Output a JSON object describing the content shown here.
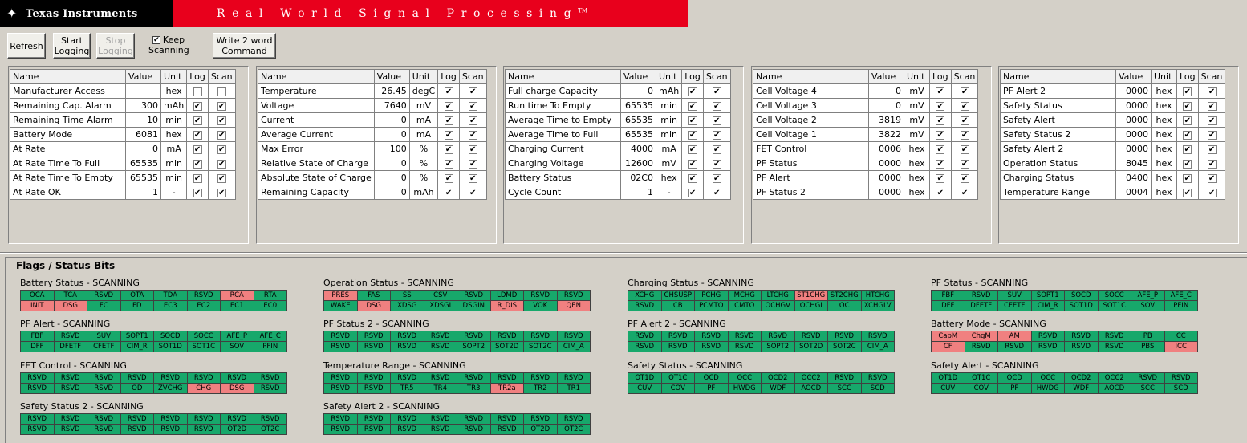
{
  "banner": {
    "company": "Texas Instruments",
    "tagline": "Real World Signal Processing",
    "tm": "TM"
  },
  "toolbar": {
    "refresh": "Refresh",
    "start_logging": "Start\nLogging",
    "stop_logging": "Stop\nLogging",
    "keep_scanning": "Keep\nScanning",
    "keep_checked": "✔",
    "write_cmd": "Write 2 word\nCommand"
  },
  "columns": {
    "name": "Name",
    "value": "Value",
    "unit": "Unit",
    "log": "Log",
    "scan": "Scan"
  },
  "panels": [
    {
      "rows": [
        {
          "name": "Manufacturer Access",
          "value": "",
          "unit": "hex",
          "log": false,
          "scan": false
        },
        {
          "name": "Remaining Cap. Alarm",
          "value": "300",
          "unit": "mAh",
          "log": true,
          "scan": true
        },
        {
          "name": "Remaining Time Alarm",
          "value": "10",
          "unit": "min",
          "log": true,
          "scan": true
        },
        {
          "name": "Battery Mode",
          "value": "6081",
          "unit": "hex",
          "log": true,
          "scan": true
        },
        {
          "name": "At Rate",
          "value": "0",
          "unit": "mA",
          "log": true,
          "scan": true
        },
        {
          "name": "At Rate Time To Full",
          "value": "65535",
          "unit": "min",
          "log": true,
          "scan": true
        },
        {
          "name": "At Rate Time To Empty",
          "value": "65535",
          "unit": "min",
          "log": true,
          "scan": true
        },
        {
          "name": "At Rate OK",
          "value": "1",
          "unit": "-",
          "log": true,
          "scan": true
        }
      ]
    },
    {
      "rows": [
        {
          "name": "Temperature",
          "value": "26.45",
          "unit": "degC",
          "log": true,
          "scan": true
        },
        {
          "name": "Voltage",
          "value": "7640",
          "unit": "mV",
          "log": true,
          "scan": true
        },
        {
          "name": "Current",
          "value": "0",
          "unit": "mA",
          "log": true,
          "scan": true
        },
        {
          "name": "Average Current",
          "value": "0",
          "unit": "mA",
          "log": true,
          "scan": true
        },
        {
          "name": "Max Error",
          "value": "100",
          "unit": "%",
          "log": true,
          "scan": true
        },
        {
          "name": "Relative State of Charge",
          "value": "0",
          "unit": "%",
          "log": true,
          "scan": true
        },
        {
          "name": "Absolute State of Charge",
          "value": "0",
          "unit": "%",
          "log": true,
          "scan": true
        },
        {
          "name": "Remaining Capacity",
          "value": "0",
          "unit": "mAh",
          "log": true,
          "scan": true
        }
      ]
    },
    {
      "rows": [
        {
          "name": "Full charge Capacity",
          "value": "0",
          "unit": "mAh",
          "log": true,
          "scan": true
        },
        {
          "name": "Run time To Empty",
          "value": "65535",
          "unit": "min",
          "log": true,
          "scan": true
        },
        {
          "name": "Average Time to Empty",
          "value": "65535",
          "unit": "min",
          "log": true,
          "scan": true
        },
        {
          "name": "Average Time to Full",
          "value": "65535",
          "unit": "min",
          "log": true,
          "scan": true
        },
        {
          "name": "Charging Current",
          "value": "4000",
          "unit": "mA",
          "log": true,
          "scan": true
        },
        {
          "name": "Charging Voltage",
          "value": "12600",
          "unit": "mV",
          "log": true,
          "scan": true
        },
        {
          "name": "Battery Status",
          "value": "02C0",
          "unit": "hex",
          "log": true,
          "scan": true
        },
        {
          "name": "Cycle Count",
          "value": "1",
          "unit": "-",
          "log": true,
          "scan": true
        }
      ]
    },
    {
      "rows": [
        {
          "name": "Cell Voltage 4",
          "value": "0",
          "unit": "mV",
          "log": true,
          "scan": true
        },
        {
          "name": "Cell Voltage 3",
          "value": "0",
          "unit": "mV",
          "log": true,
          "scan": true
        },
        {
          "name": "Cell Voltage 2",
          "value": "3819",
          "unit": "mV",
          "log": true,
          "scan": true
        },
        {
          "name": "Cell Voltage 1",
          "value": "3822",
          "unit": "mV",
          "log": true,
          "scan": true
        },
        {
          "name": "FET Control",
          "value": "0006",
          "unit": "hex",
          "log": true,
          "scan": true
        },
        {
          "name": "PF Status",
          "value": "0000",
          "unit": "hex",
          "log": true,
          "scan": true
        },
        {
          "name": "PF Alert",
          "value": "0000",
          "unit": "hex",
          "log": true,
          "scan": true
        },
        {
          "name": "PF Status 2",
          "value": "0000",
          "unit": "hex",
          "log": true,
          "scan": true
        }
      ]
    },
    {
      "rows": [
        {
          "name": "PF Alert 2",
          "value": "0000",
          "unit": "hex",
          "log": true,
          "scan": true
        },
        {
          "name": "Safety Status",
          "value": "0000",
          "unit": "hex",
          "log": true,
          "scan": true
        },
        {
          "name": "Safety Alert",
          "value": "0000",
          "unit": "hex",
          "log": true,
          "scan": true
        },
        {
          "name": "Safety Status 2",
          "value": "0000",
          "unit": "hex",
          "log": true,
          "scan": true
        },
        {
          "name": "Safety Alert 2",
          "value": "0000",
          "unit": "hex",
          "log": true,
          "scan": true
        },
        {
          "name": "Operation Status",
          "value": "8045",
          "unit": "hex",
          "log": true,
          "scan": true
        },
        {
          "name": "Charging Status",
          "value": "0400",
          "unit": "hex",
          "log": true,
          "scan": true
        },
        {
          "name": "Temperature Range",
          "value": "0004",
          "unit": "hex",
          "log": true,
          "scan": true
        }
      ]
    }
  ],
  "flags_title": "Flags / Status Bits",
  "flag_groups": [
    {
      "title": "Battery Status - SCANNING",
      "rows": [
        [
          "OCA",
          "TCA",
          "RSVD",
          "OTA",
          "TDA",
          "RSVD",
          "RCA",
          "RTA"
        ],
        [
          "INIT",
          "DSG",
          "FC",
          "FD",
          "EC3",
          "EC2",
          "EC1",
          "EC0"
        ]
      ],
      "set": [
        [
          0,
          0,
          0,
          0,
          0,
          0,
          1,
          0
        ],
        [
          1,
          1,
          0,
          0,
          0,
          0,
          0,
          0
        ]
      ]
    },
    {
      "title": "Operation Status - SCANNING",
      "rows": [
        [
          "PRES",
          "FAS",
          "SS",
          "CSV",
          "RSVD",
          "LDMD",
          "RSVD",
          "RSVD"
        ],
        [
          "WAKE",
          "DSG",
          "XDSG",
          "XDSGI",
          "DSGIN",
          "R_DIS",
          "VOK",
          "QEN"
        ]
      ],
      "set": [
        [
          1,
          0,
          0,
          0,
          0,
          0,
          0,
          0
        ],
        [
          0,
          1,
          0,
          0,
          0,
          1,
          0,
          1
        ]
      ]
    },
    {
      "title": "Charging Status - SCANNING",
      "rows": [
        [
          "XCHG",
          "CHSUSP",
          "PCHG",
          "MCHG",
          "LTCHG",
          "ST1CHG",
          "ST2CHG",
          "HTCHG"
        ],
        [
          "RSVD",
          "CB",
          "PCMTO",
          "CMTO",
          "OCHGV",
          "OCHGI",
          "OC",
          "XCHGLV"
        ]
      ],
      "set": [
        [
          0,
          0,
          0,
          0,
          0,
          1,
          0,
          0
        ],
        [
          0,
          0,
          0,
          0,
          0,
          0,
          0,
          0
        ]
      ]
    },
    {
      "title": "PF Status - SCANNING",
      "rows": [
        [
          "FBF",
          "RSVD",
          "SUV",
          "SOPT1",
          "SOCD",
          "SOCC",
          "AFE_P",
          "AFE_C"
        ],
        [
          "DFF",
          "DFETF",
          "CFETF",
          "CIM_R",
          "SOT1D",
          "SOT1C",
          "SOV",
          "PFIN"
        ]
      ],
      "set": [
        [
          0,
          0,
          0,
          0,
          0,
          0,
          0,
          0
        ],
        [
          0,
          0,
          0,
          0,
          0,
          0,
          0,
          0
        ]
      ]
    },
    {
      "title": "PF Alert - SCANNING",
      "rows": [
        [
          "FBF",
          "RSVD",
          "SUV",
          "SOPT1",
          "SOCD",
          "SOCC",
          "AFE_P",
          "AFE_C"
        ],
        [
          "DFF",
          "DFETF",
          "CFETF",
          "CIM_R",
          "SOT1D",
          "SOT1C",
          "SOV",
          "PFIN"
        ]
      ],
      "set": [
        [
          0,
          0,
          0,
          0,
          0,
          0,
          0,
          0
        ],
        [
          0,
          0,
          0,
          0,
          0,
          0,
          0,
          0
        ]
      ]
    },
    {
      "title": "PF Status 2 - SCANNING",
      "rows": [
        [
          "RSVD",
          "RSVD",
          "RSVD",
          "RSVD",
          "RSVD",
          "RSVD",
          "RSVD",
          "RSVD"
        ],
        [
          "RSVD",
          "RSVD",
          "RSVD",
          "RSVD",
          "SOPT2",
          "SOT2D",
          "SOT2C",
          "CIM_A"
        ]
      ],
      "set": [
        [
          0,
          0,
          0,
          0,
          0,
          0,
          0,
          0
        ],
        [
          0,
          0,
          0,
          0,
          0,
          0,
          0,
          0
        ]
      ]
    },
    {
      "title": "PF Alert 2 - SCANNING",
      "rows": [
        [
          "RSVD",
          "RSVD",
          "RSVD",
          "RSVD",
          "RSVD",
          "RSVD",
          "RSVD",
          "RSVD"
        ],
        [
          "RSVD",
          "RSVD",
          "RSVD",
          "RSVD",
          "SOPT2",
          "SOT2D",
          "SOT2C",
          "CIM_A"
        ]
      ],
      "set": [
        [
          0,
          0,
          0,
          0,
          0,
          0,
          0,
          0
        ],
        [
          0,
          0,
          0,
          0,
          0,
          0,
          0,
          0
        ]
      ]
    },
    {
      "title": "Battery Mode - SCANNING",
      "rows": [
        [
          "CapM",
          "ChgM",
          "AM",
          "RSVD",
          "RSVD",
          "RSVD",
          "PB",
          "CC"
        ],
        [
          "CF",
          "RSVD",
          "RSVD",
          "RSVD",
          "RSVD",
          "RSVD",
          "PBS",
          "ICC"
        ]
      ],
      "set": [
        [
          1,
          1,
          1,
          0,
          0,
          0,
          0,
          0
        ],
        [
          1,
          0,
          0,
          0,
          0,
          0,
          0,
          1
        ]
      ]
    },
    {
      "title": "FET Control - SCANNING",
      "rows": [
        [
          "RSVD",
          "RSVD",
          "RSVD",
          "RSVD",
          "RSVD",
          "RSVD",
          "RSVD",
          "RSVD"
        ],
        [
          "RSVD",
          "RSVD",
          "RSVD",
          "OD",
          "ZVCHG",
          "CHG",
          "DSG",
          "RSVD"
        ]
      ],
      "set": [
        [
          0,
          0,
          0,
          0,
          0,
          0,
          0,
          0
        ],
        [
          0,
          0,
          0,
          0,
          0,
          1,
          1,
          0
        ]
      ]
    },
    {
      "title": "Temperature Range - SCANNING",
      "rows": [
        [
          "RSVD",
          "RSVD",
          "RSVD",
          "RSVD",
          "RSVD",
          "RSVD",
          "RSVD",
          "RSVD"
        ],
        [
          "RSVD",
          "RSVD",
          "TR5",
          "TR4",
          "TR3",
          "TR2a",
          "TR2",
          "TR1"
        ]
      ],
      "set": [
        [
          0,
          0,
          0,
          0,
          0,
          0,
          0,
          0
        ],
        [
          0,
          0,
          0,
          0,
          0,
          1,
          0,
          0
        ]
      ]
    },
    {
      "title": "Safety Status - SCANNING",
      "rows": [
        [
          "OT1D",
          "OT1C",
          "OCD",
          "OCC",
          "OCD2",
          "OCC2",
          "RSVD",
          "RSVD"
        ],
        [
          "CUV",
          "COV",
          "PF",
          "HWDG",
          "WDF",
          "AOCD",
          "SCC",
          "SCD"
        ]
      ],
      "set": [
        [
          0,
          0,
          0,
          0,
          0,
          0,
          0,
          0
        ],
        [
          0,
          0,
          0,
          0,
          0,
          0,
          0,
          0
        ]
      ]
    },
    {
      "title": "Safety Alert - SCANNING",
      "rows": [
        [
          "OT1D",
          "OT1C",
          "OCD",
          "OCC",
          "OCD2",
          "OCC2",
          "RSVD",
          "RSVD"
        ],
        [
          "CUV",
          "COV",
          "PF",
          "HWDG",
          "WDF",
          "AOCD",
          "SCC",
          "SCD"
        ]
      ],
      "set": [
        [
          0,
          0,
          0,
          0,
          0,
          0,
          0,
          0
        ],
        [
          0,
          0,
          0,
          0,
          0,
          0,
          0,
          0
        ]
      ]
    },
    {
      "title": "Safety Status 2 - SCANNING",
      "rows": [
        [
          "RSVD",
          "RSVD",
          "RSVD",
          "RSVD",
          "RSVD",
          "RSVD",
          "RSVD",
          "RSVD"
        ],
        [
          "RSVD",
          "RSVD",
          "RSVD",
          "RSVD",
          "RSVD",
          "RSVD",
          "OT2D",
          "OT2C"
        ]
      ],
      "set": [
        [
          0,
          0,
          0,
          0,
          0,
          0,
          0,
          0
        ],
        [
          0,
          0,
          0,
          0,
          0,
          0,
          0,
          0
        ]
      ]
    },
    {
      "title": "Safety Alert 2 - SCANNING",
      "rows": [
        [
          "RSVD",
          "RSVD",
          "RSVD",
          "RSVD",
          "RSVD",
          "RSVD",
          "RSVD",
          "RSVD"
        ],
        [
          "RSVD",
          "RSVD",
          "RSVD",
          "RSVD",
          "RSVD",
          "RSVD",
          "OT2D",
          "OT2C"
        ]
      ],
      "set": [
        [
          0,
          0,
          0,
          0,
          0,
          0,
          0,
          0
        ],
        [
          0,
          0,
          0,
          0,
          0,
          0,
          0,
          0
        ]
      ]
    }
  ],
  "colors": {
    "bit_clear": "#17a86b",
    "bit_set": "#f08080",
    "banner": "#e8001c"
  }
}
